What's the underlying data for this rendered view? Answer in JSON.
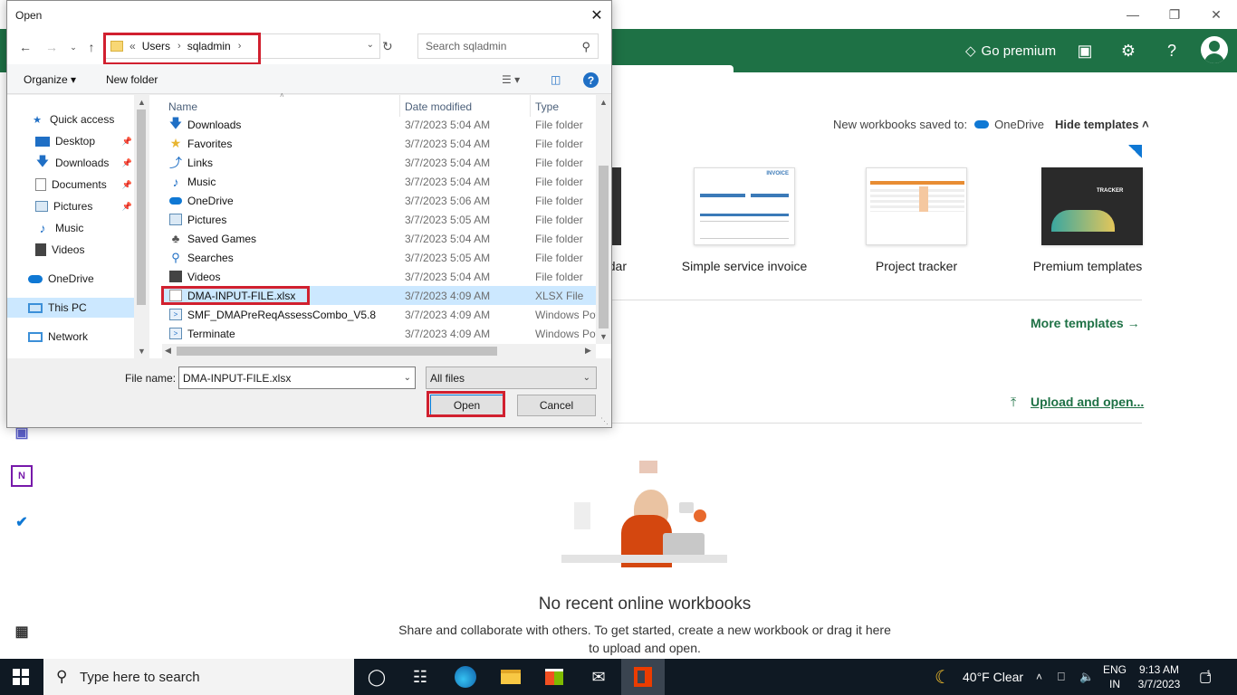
{
  "background": {
    "header": {
      "go_premium": "Go premium"
    },
    "new_saved_label": "New workbooks saved to:",
    "new_saved_location": "OneDrive",
    "hide_templates": "Hide templates",
    "templates": [
      {
        "label": "dar"
      },
      {
        "label": "Simple service invoice",
        "thumb_text": "INVOICE"
      },
      {
        "label": "Project tracker"
      },
      {
        "label": "Premium templates",
        "thumb_text": "TRACKER"
      }
    ],
    "more_templates": "More templates",
    "upload_open": "Upload and open...",
    "empty_title": "No recent online workbooks",
    "empty_desc": "Share and collaborate with others. To get started, create a new workbook or drag it here to upload and open."
  },
  "dialog": {
    "title": "Open",
    "breadcrumb": [
      "Users",
      "sqladmin"
    ],
    "breadcrumb_prefix": "«",
    "search_placeholder": "Search sqladmin",
    "toolbar": {
      "organize": "Organize",
      "new_folder": "New folder"
    },
    "nav_items": [
      {
        "label": "Quick access",
        "icon": "star-icon",
        "pinned": false,
        "selected": false
      },
      {
        "label": "Desktop",
        "icon": "desktop-icon",
        "pinned": true,
        "selected": false
      },
      {
        "label": "Downloads",
        "icon": "download-icon",
        "pinned": true,
        "selected": false
      },
      {
        "label": "Documents",
        "icon": "documents-icon",
        "pinned": true,
        "selected": false
      },
      {
        "label": "Pictures",
        "icon": "pictures-icon",
        "pinned": true,
        "selected": false
      },
      {
        "label": "Music",
        "icon": "music-icon",
        "pinned": false,
        "selected": false
      },
      {
        "label": "Videos",
        "icon": "videos-icon",
        "pinned": false,
        "selected": false
      },
      {
        "label": "OneDrive",
        "icon": "onedrive-icon",
        "pinned": false,
        "selected": false
      },
      {
        "label": "This PC",
        "icon": "computer-icon",
        "pinned": false,
        "selected": true
      },
      {
        "label": "Network",
        "icon": "network-icon",
        "pinned": false,
        "selected": false
      }
    ],
    "columns": {
      "name": "Name",
      "date": "Date modified",
      "type": "Type"
    },
    "files": [
      {
        "name": "Downloads",
        "date": "3/7/2023 5:04 AM",
        "type": "File folder",
        "icon": "download-icon"
      },
      {
        "name": "Favorites",
        "date": "3/7/2023 5:04 AM",
        "type": "File folder",
        "icon": "star-icon"
      },
      {
        "name": "Links",
        "date": "3/7/2023 5:04 AM",
        "type": "File folder",
        "icon": "link-icon"
      },
      {
        "name": "Music",
        "date": "3/7/2023 5:04 AM",
        "type": "File folder",
        "icon": "music-icon"
      },
      {
        "name": "OneDrive",
        "date": "3/7/2023 5:06 AM",
        "type": "File folder",
        "icon": "onedrive-icon"
      },
      {
        "name": "Pictures",
        "date": "3/7/2023 5:05 AM",
        "type": "File folder",
        "icon": "pictures-icon"
      },
      {
        "name": "Saved Games",
        "date": "3/7/2023 5:04 AM",
        "type": "File folder",
        "icon": "games-icon"
      },
      {
        "name": "Searches",
        "date": "3/7/2023 5:05 AM",
        "type": "File folder",
        "icon": "search-icon"
      },
      {
        "name": "Videos",
        "date": "3/7/2023 5:04 AM",
        "type": "File folder",
        "icon": "videos-icon"
      },
      {
        "name": "DMA-INPUT-FILE.xlsx",
        "date": "3/7/2023 4:09 AM",
        "type": "XLSX File",
        "icon": "file-icon",
        "selected": true
      },
      {
        "name": "SMF_DMAPreReqAssessCombo_V5.8",
        "date": "3/7/2023 4:09 AM",
        "type": "Windows Pow",
        "icon": "script-icon"
      },
      {
        "name": "Terminate",
        "date": "3/7/2023 4:09 AM",
        "type": "Windows Pow",
        "icon": "script-icon"
      }
    ],
    "file_name_label": "File name:",
    "file_name_value": "DMA-INPUT-FILE.xlsx",
    "file_type_filter": "All files",
    "open_button": "Open",
    "cancel_button": "Cancel"
  },
  "taskbar": {
    "search_placeholder": "Type here to search",
    "weather": "40°F  Clear",
    "lang_top": "ENG",
    "lang_bottom": "IN",
    "time": "9:13 AM",
    "date": "3/7/2023",
    "notification_count": "1"
  }
}
